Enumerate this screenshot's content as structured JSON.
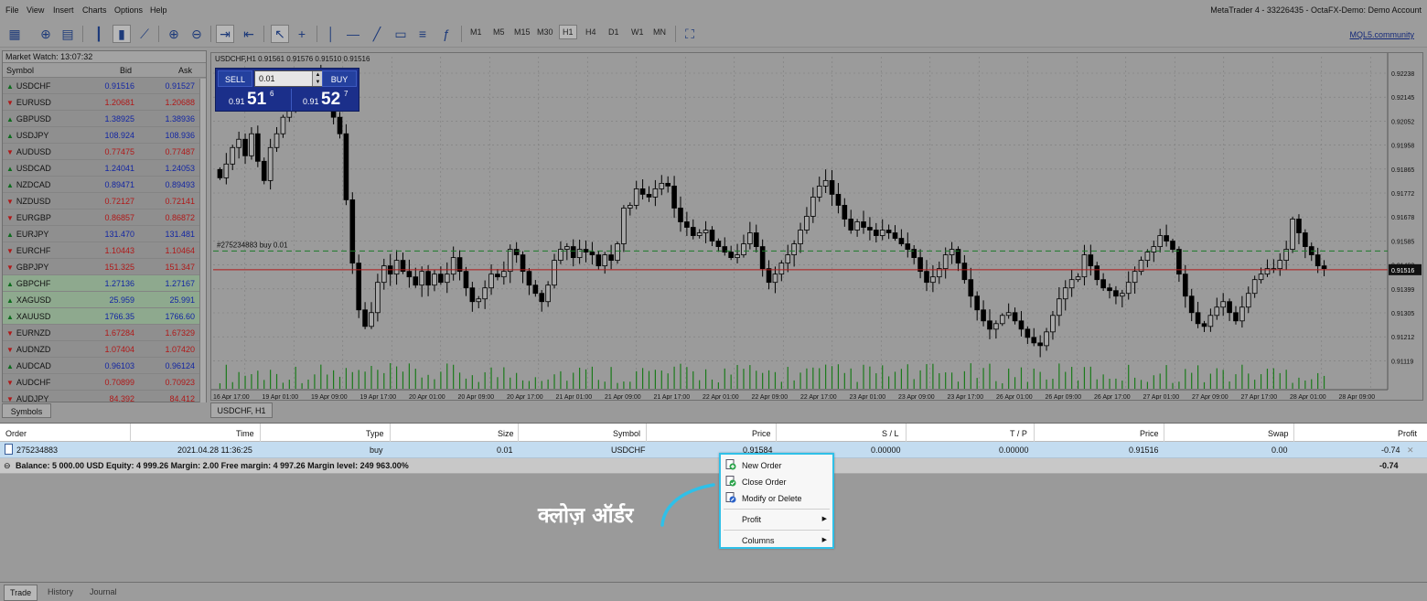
{
  "menu": [
    "File",
    "View",
    "Insert",
    "Charts",
    "Options",
    "Help"
  ],
  "window_title": "MetaTrader 4 - 33226435 - OctaFX-Demo: Demo Account",
  "timeframes": [
    "M1",
    "M5",
    "M15",
    "M30",
    "H1",
    "H4",
    "D1",
    "W1",
    "MN"
  ],
  "active_timeframe": "H1",
  "mql5_link": "MQL5.community",
  "market_watch": {
    "title": "Market Watch: 13:07:32",
    "col_symbol": "Symbol",
    "col_bid": "Bid",
    "col_ask": "Ask",
    "tab": "Symbols",
    "rows": [
      {
        "symbol": "USDCHF",
        "bid": "0.91516",
        "ask": "0.91527",
        "dir": "up"
      },
      {
        "symbol": "EURUSD",
        "bid": "1.20681",
        "ask": "1.20688",
        "dir": "down"
      },
      {
        "symbol": "GBPUSD",
        "bid": "1.38925",
        "ask": "1.38936",
        "dir": "up"
      },
      {
        "symbol": "USDJPY",
        "bid": "108.924",
        "ask": "108.936",
        "dir": "up"
      },
      {
        "symbol": "AUDUSD",
        "bid": "0.77475",
        "ask": "0.77487",
        "dir": "down"
      },
      {
        "symbol": "USDCAD",
        "bid": "1.24041",
        "ask": "1.24053",
        "dir": "up"
      },
      {
        "symbol": "NZDCAD",
        "bid": "0.89471",
        "ask": "0.89493",
        "dir": "up"
      },
      {
        "symbol": "NZDUSD",
        "bid": "0.72127",
        "ask": "0.72141",
        "dir": "down"
      },
      {
        "symbol": "EURGBP",
        "bid": "0.86857",
        "ask": "0.86872",
        "dir": "down"
      },
      {
        "symbol": "EURJPY",
        "bid": "131.470",
        "ask": "131.481",
        "dir": "up"
      },
      {
        "symbol": "EURCHF",
        "bid": "1.10443",
        "ask": "1.10464",
        "dir": "down"
      },
      {
        "symbol": "GBPJPY",
        "bid": "151.325",
        "ask": "151.347",
        "dir": "down"
      },
      {
        "symbol": "GBPCHF",
        "bid": "1.27136",
        "ask": "1.27167",
        "dir": "up"
      },
      {
        "symbol": "XAGUSD",
        "bid": "25.959",
        "ask": "25.991",
        "dir": "up"
      },
      {
        "symbol": "XAUUSD",
        "bid": "1766.35",
        "ask": "1766.60",
        "dir": "up"
      },
      {
        "symbol": "EURNZD",
        "bid": "1.67284",
        "ask": "1.67329",
        "dir": "down"
      },
      {
        "symbol": "AUDNZD",
        "bid": "1.07404",
        "ask": "1.07420",
        "dir": "down"
      },
      {
        "symbol": "AUDCAD",
        "bid": "0.96103",
        "ask": "0.96124",
        "dir": "up"
      },
      {
        "symbol": "AUDCHF",
        "bid": "0.70899",
        "ask": "0.70923",
        "dir": "down"
      },
      {
        "symbol": "AUDJPY",
        "bid": "84.392",
        "ask": "84.412",
        "dir": "down"
      }
    ]
  },
  "chart": {
    "info": "USDCHF,H1  0.91561 0.91576 0.91510 0.91516",
    "tab": "USDCHF, H1",
    "one_click": {
      "sell": "SELL",
      "buy": "BUY",
      "lot": "0.01",
      "bid_small": "0.91",
      "bid_big": "51",
      "bid_sup": "6",
      "ask_small": "0.91",
      "ask_big": "52",
      "ask_sup": "7"
    },
    "order_label": "#275234883 buy 0.01",
    "current_price_label": "0.91516"
  },
  "chart_data": {
    "type": "candlestick",
    "y_ticks": [
      "0.92238",
      "0.92145",
      "0.92052",
      "0.91958",
      "0.91865",
      "0.91772",
      "0.91678",
      "0.91585",
      "0.91492",
      "0.91399",
      "0.91305",
      "0.91212",
      "0.91119"
    ],
    "x_ticks": [
      "16 Apr 17:00",
      "19 Apr 01:00",
      "19 Apr 09:00",
      "19 Apr 17:00",
      "20 Apr 01:00",
      "20 Apr 09:00",
      "20 Apr 17:00",
      "21 Apr 01:00",
      "21 Apr 09:00",
      "21 Apr 17:00",
      "22 Apr 01:00",
      "22 Apr 09:00",
      "22 Apr 17:00",
      "23 Apr 01:00",
      "23 Apr 09:00",
      "23 Apr 17:00",
      "26 Apr 01:00",
      "26 Apr 09:00",
      "26 Apr 17:00",
      "27 Apr 01:00",
      "27 Apr 09:00",
      "27 Apr 17:00",
      "28 Apr 01:00",
      "28 Apr 09:00"
    ],
    "ylim": [
      0.9108,
      0.9229
    ],
    "order_price": 0.91584,
    "current_price": 0.91516,
    "closes": [
      0.9185,
      0.919,
      0.9196,
      0.9199,
      0.9193,
      0.9201,
      0.9191,
      0.9184,
      0.9196,
      0.9201,
      0.9207,
      0.9212,
      0.9215,
      0.9216,
      0.9218,
      0.9222,
      0.922,
      0.9214,
      0.9207,
      0.9201,
      0.9177,
      0.9154,
      0.9137,
      0.9131,
      0.9136,
      0.9147,
      0.9153,
      0.915,
      0.9155,
      0.9151,
      0.9149,
      0.9146,
      0.9151,
      0.9146,
      0.915,
      0.9147,
      0.915,
      0.9156,
      0.9151,
      0.9145,
      0.914,
      0.9141,
      0.9145,
      0.915,
      0.9149,
      0.9151,
      0.9159,
      0.9157,
      0.9151,
      0.9146,
      0.9143,
      0.914,
      0.9146,
      0.9155,
      0.9159,
      0.916,
      0.9156,
      0.9159,
      0.9158,
      0.9157,
      0.9153,
      0.9157,
      0.9155,
      0.9161,
      0.9174,
      0.9175,
      0.9181,
      0.9179,
      0.9178,
      0.9181,
      0.9183,
      0.9182,
      0.9174,
      0.9169,
      0.9167,
      0.9164,
      0.9165,
      0.9166,
      0.9162,
      0.916,
      0.9158,
      0.9156,
      0.9157,
      0.9161,
      0.9165,
      0.916,
      0.9152,
      0.9147,
      0.915,
      0.9154,
      0.9157,
      0.9161,
      0.9166,
      0.9171,
      0.9178,
      0.9182,
      0.9184,
      0.9179,
      0.9175,
      0.917,
      0.9166,
      0.9169,
      0.9167,
      0.9166,
      0.9164,
      0.9166,
      0.9165,
      0.9163,
      0.9161,
      0.9159,
      0.9156,
      0.9151,
      0.9147,
      0.9149,
      0.9152,
      0.9157,
      0.9159,
      0.9154,
      0.9148,
      0.9142,
      0.9137,
      0.9133,
      0.913,
      0.9132,
      0.9135,
      0.9136,
      0.9133,
      0.913,
      0.9127,
      0.9125,
      0.9124,
      0.9129,
      0.9135,
      0.9141,
      0.9145,
      0.9148,
      0.9149,
      0.9157,
      0.9153,
      0.9148,
      0.9145,
      0.9144,
      0.9142,
      0.9143,
      0.9147,
      0.9151,
      0.9155,
      0.9158,
      0.916,
      0.9164,
      0.9162,
      0.9159,
      0.915,
      0.9142,
      0.9136,
      0.9132,
      0.9131,
      0.9135,
      0.9138,
      0.914,
      0.9136,
      0.9133,
      0.9138,
      0.9143,
      0.9148,
      0.915,
      0.9152,
      0.9152,
      0.9155,
      0.9159,
      0.917,
      0.9165,
      0.916,
      0.9157,
      0.9153,
      0.9152
    ]
  },
  "trade": {
    "headers": [
      "Order",
      "Time",
      "Type",
      "Size",
      "Symbol",
      "Price",
      "S / L",
      "T / P",
      "Price",
      "Swap",
      "Profit"
    ],
    "row": {
      "order": "275234883",
      "time": "2021.04.28 11:36:25",
      "type": "buy",
      "size": "0.01",
      "symbol": "USDCHF",
      "price": "0.91584",
      "sl": "0.00000",
      "tp": "0.00000",
      "cur_price": "0.91516",
      "swap": "0.00",
      "profit": "-0.74"
    },
    "balance_line": "Balance: 5 000.00 USD  Equity: 4 999.26  Margin: 2.00  Free margin: 4 997.26  Margin level: 249 963.00%",
    "balance_profit": "-0.74"
  },
  "bottom_tabs": [
    "Trade",
    "History",
    "Journal"
  ],
  "context_menu": {
    "new_order": "New Order",
    "close_order": "Close Order",
    "modify_delete": "Modify or Delete",
    "profit": "Profit",
    "columns": "Columns"
  },
  "callout": "क्लोज़ ऑर्डर",
  "colors": {
    "up": "#0d6b1d",
    "down": "#b01818",
    "bid_ask": "#1326a3",
    "highlight": "#2fc0e8"
  }
}
